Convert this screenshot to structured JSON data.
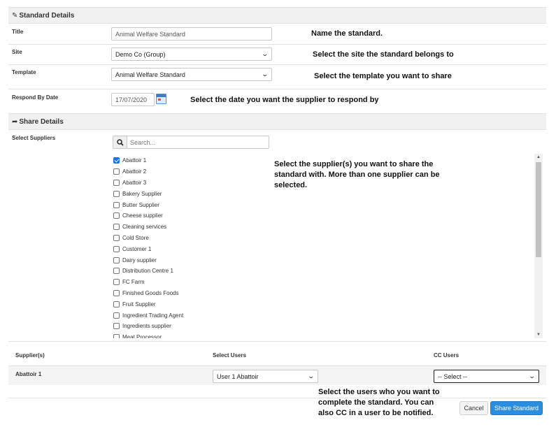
{
  "standard_details": {
    "heading": "Standard Details",
    "title_label": "Title",
    "title_value": "Animal Welfare Standard",
    "site_label": "Site",
    "site_value": "Demo Co (Group)",
    "template_label": "Template",
    "template_value": "Animal Welfare Standard",
    "respond_label": "Respond By Date",
    "respond_value": "17/07/2020"
  },
  "share_details": {
    "heading": "Share Details",
    "select_suppliers_label": "Select Suppliers",
    "search_placeholder": "Search...",
    "suppliers": [
      {
        "name": "Abattoir 1",
        "checked": true
      },
      {
        "name": "Abattoir 2",
        "checked": false
      },
      {
        "name": "Abattoir 3",
        "checked": false
      },
      {
        "name": "Bakery Supplier",
        "checked": false
      },
      {
        "name": "Butter Supplier",
        "checked": false
      },
      {
        "name": "Cheese supplier",
        "checked": false
      },
      {
        "name": "Cleaning services",
        "checked": false
      },
      {
        "name": "Cold Store",
        "checked": false
      },
      {
        "name": "Customer 1",
        "checked": false
      },
      {
        "name": "Dairy supplier",
        "checked": false
      },
      {
        "name": "Distribution Centre 1",
        "checked": false
      },
      {
        "name": "FC Farm",
        "checked": false
      },
      {
        "name": "Finished Goods Foods",
        "checked": false
      },
      {
        "name": "Fruit Supplier",
        "checked": false
      },
      {
        "name": "Ingredient Trading Agent",
        "checked": false
      },
      {
        "name": "Ingredients supplier",
        "checked": false
      },
      {
        "name": "Meat Processor",
        "checked": false
      }
    ]
  },
  "table": {
    "col_suppliers": "Supplier(s)",
    "col_select_users": "Select Users",
    "col_cc_users": "CC Users",
    "row_supplier": "Abattoir 1",
    "row_user": "User 1 Abattoir",
    "row_cc": "-- Select --"
  },
  "annotations": {
    "name": "Name the standard.",
    "site": "Select the site the standard belongs to",
    "template": "Select the template you want to share",
    "date": "Select the date you want the supplier to respond by",
    "suppliers_line1": "Select the supplier(s) you want to share the",
    "suppliers_line2": "standard with. More than one supplier can be",
    "suppliers_line3": "selected.",
    "users_line1": "Select the users who you want to",
    "users_line2": "complete the standard. You can",
    "users_line3": "also CC in a user to be notified."
  },
  "buttons": {
    "cancel": "Cancel",
    "share": "Share Standard"
  },
  "icons": {
    "edit": "edit-icon",
    "share": "share-arrow-icon",
    "search": "search-icon",
    "calendar": "calendar-icon"
  }
}
